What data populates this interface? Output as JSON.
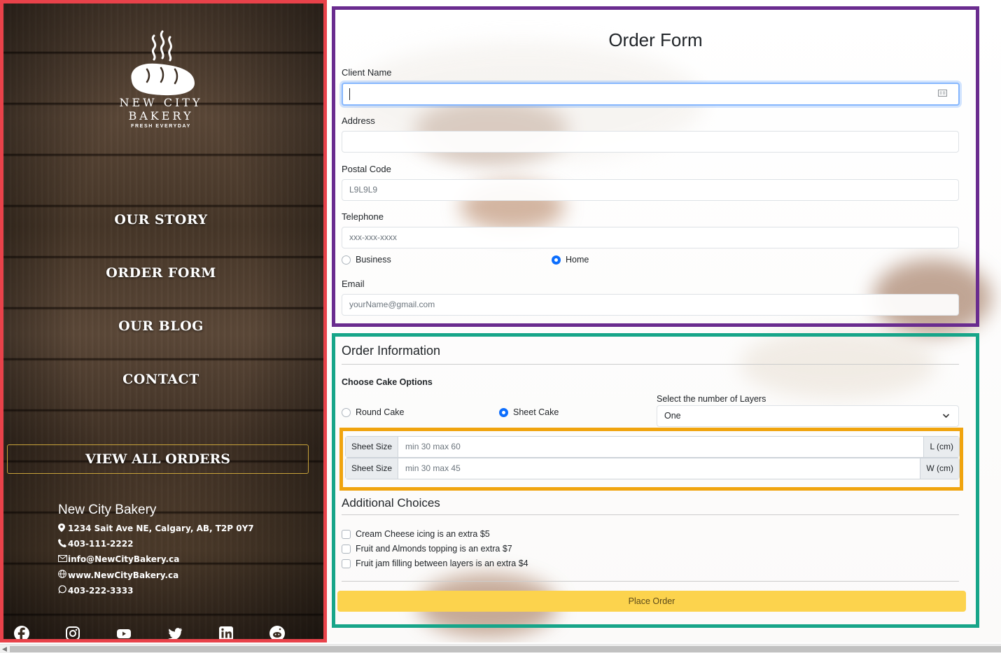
{
  "brand": {
    "line1": "NEW CITY",
    "line2": "BAKERY",
    "tagline": "FRESH EVERYDAY"
  },
  "nav": {
    "our_story": "OUR STORY",
    "order_form": "ORDER FORM",
    "our_blog": "OUR BLOG",
    "contact": "CONTACT",
    "view_all_orders": "VIEW ALL ORDERS"
  },
  "contact": {
    "name": "New City Bakery",
    "address": "1234 Sait Ave NE, Calgary, AB, T2P 0Y7",
    "phone": "403-111-2222",
    "email": "info@NewCityBakery.ca",
    "website": "www.NewCityBakery.ca",
    "whatsapp": "403-222-3333"
  },
  "socials": [
    "facebook-icon",
    "instagram-icon",
    "youtube-icon",
    "twitter-icon",
    "linkedin-icon",
    "reddit-icon"
  ],
  "order_form": {
    "title": "Order Form",
    "client_name_label": "Client Name",
    "client_name_value": "",
    "address_label": "Address",
    "address_value": "",
    "postal_code_label": "Postal Code",
    "postal_code_placeholder": "L9L9L9",
    "telephone_label": "Telephone",
    "telephone_placeholder": "xxx-xxx-xxxx",
    "phone_type_business": "Business",
    "phone_type_home": "Home",
    "phone_type_selected": "Home",
    "email_label": "Email",
    "email_placeholder": "yourName@gmail.com"
  },
  "order_info": {
    "title": "Order Information",
    "cake_options_label": "Choose Cake Options",
    "round_cake": "Round Cake",
    "sheet_cake": "Sheet Cake",
    "cake_selected": "Sheet Cake",
    "layers_label": "Select the number of Layers",
    "layers_value": "One",
    "sheet_length_label": "Sheet Size",
    "sheet_length_placeholder": "min 30 max 60",
    "sheet_length_unit": "L (cm)",
    "sheet_width_label": "Sheet Size",
    "sheet_width_placeholder": "min 30 max 45",
    "sheet_width_unit": "W (cm)",
    "additional_title": "Additional Choices",
    "extras": [
      "Cream Cheese icing is an extra $5",
      "Fruit and Almonds topping is an extra $7",
      "Fruit jam filling between layers is an extra $4"
    ],
    "place_order": "Place Order"
  },
  "colors": {
    "sidebar_outline": "#e8424a",
    "order_form_outline": "#6a2c8f",
    "order_info_outline": "#17a589",
    "sheet_size_outline": "#f0a40e",
    "place_order_button": "#fcd34d",
    "radio_selected": "#0d6efd"
  }
}
